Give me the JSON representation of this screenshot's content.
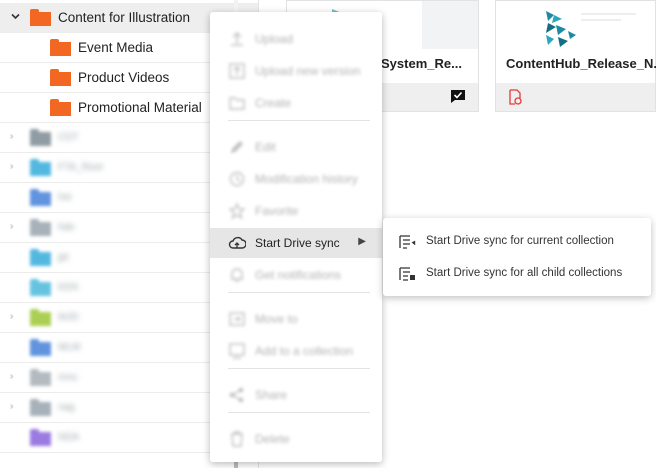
{
  "tree": {
    "root": {
      "label": "Content for Illustration",
      "expanded": true,
      "color": "#f26722"
    },
    "children": [
      {
        "label": "Event Media",
        "color": "#f26722"
      },
      {
        "label": "Product Videos",
        "color": "#f26722"
      },
      {
        "label": "Promotional Material",
        "color": "#f26722"
      }
    ],
    "blurred_folders": [
      {
        "label": "CDT",
        "color": "#6b7a84",
        "collapsible": true
      },
      {
        "label": "FTA_Root",
        "color": "#1aa1d6",
        "collapsible": true
      },
      {
        "label": "hst",
        "color": "#2d6fd3",
        "collapsible": false
      },
      {
        "label": "hde",
        "color": "#8a98a3",
        "collapsible": true
      },
      {
        "label": "jpt",
        "color": "#1aa1d6",
        "collapsible": false
      },
      {
        "label": "KDS",
        "color": "#33b0d6",
        "collapsible": false
      },
      {
        "label": "MJD",
        "color": "#8fbf1c",
        "collapsible": true
      },
      {
        "label": "MLM",
        "color": "#2d6fd3",
        "collapsible": false
      },
      {
        "label": "mnu",
        "color": "#9aa5ad",
        "collapsible": true
      },
      {
        "label": "nag",
        "color": "#8a98a3",
        "collapsible": true
      },
      {
        "label": "NDA",
        "color": "#7a4fd6",
        "collapsible": false
      }
    ]
  },
  "cards": [
    {
      "title": "System_Re...",
      "icon": "chat-check-icon"
    },
    {
      "title": "ContentHub_Release_N...",
      "icon": "drive-sync-error-icon",
      "icon_color": "#e53935"
    }
  ],
  "context_menu": {
    "items": [
      {
        "label": "Upload",
        "icon": "upload-icon",
        "disabled": true
      },
      {
        "label": "Upload new version",
        "icon": "upload-version-icon",
        "disabled": true
      },
      {
        "label": "Create",
        "icon": "create-folder-icon",
        "disabled": true
      },
      {
        "label": "Edit",
        "icon": "pencil-icon",
        "disabled": true
      },
      {
        "label": "Modification history",
        "icon": "history-icon",
        "disabled": true
      },
      {
        "label": "Favorite",
        "icon": "star-icon",
        "disabled": true
      },
      {
        "label": "Start Drive sync",
        "icon": "cloud-sync-icon",
        "disabled": false,
        "has_submenu": true
      },
      {
        "label": "Get notifications",
        "icon": "bell-icon",
        "disabled": true
      },
      {
        "label": "Move to",
        "icon": "move-icon",
        "disabled": true
      },
      {
        "label": "Add to a collection",
        "icon": "collection-icon",
        "disabled": true
      },
      {
        "label": "Share",
        "icon": "share-icon",
        "disabled": true
      },
      {
        "label": "Delete",
        "icon": "trash-icon",
        "disabled": true
      }
    ]
  },
  "submenu": {
    "items": [
      {
        "label": "Start Drive sync for current collection",
        "icon": "sync-current-collection-icon"
      },
      {
        "label": "Start Drive sync for all child collections",
        "icon": "sync-child-collections-icon"
      }
    ]
  }
}
